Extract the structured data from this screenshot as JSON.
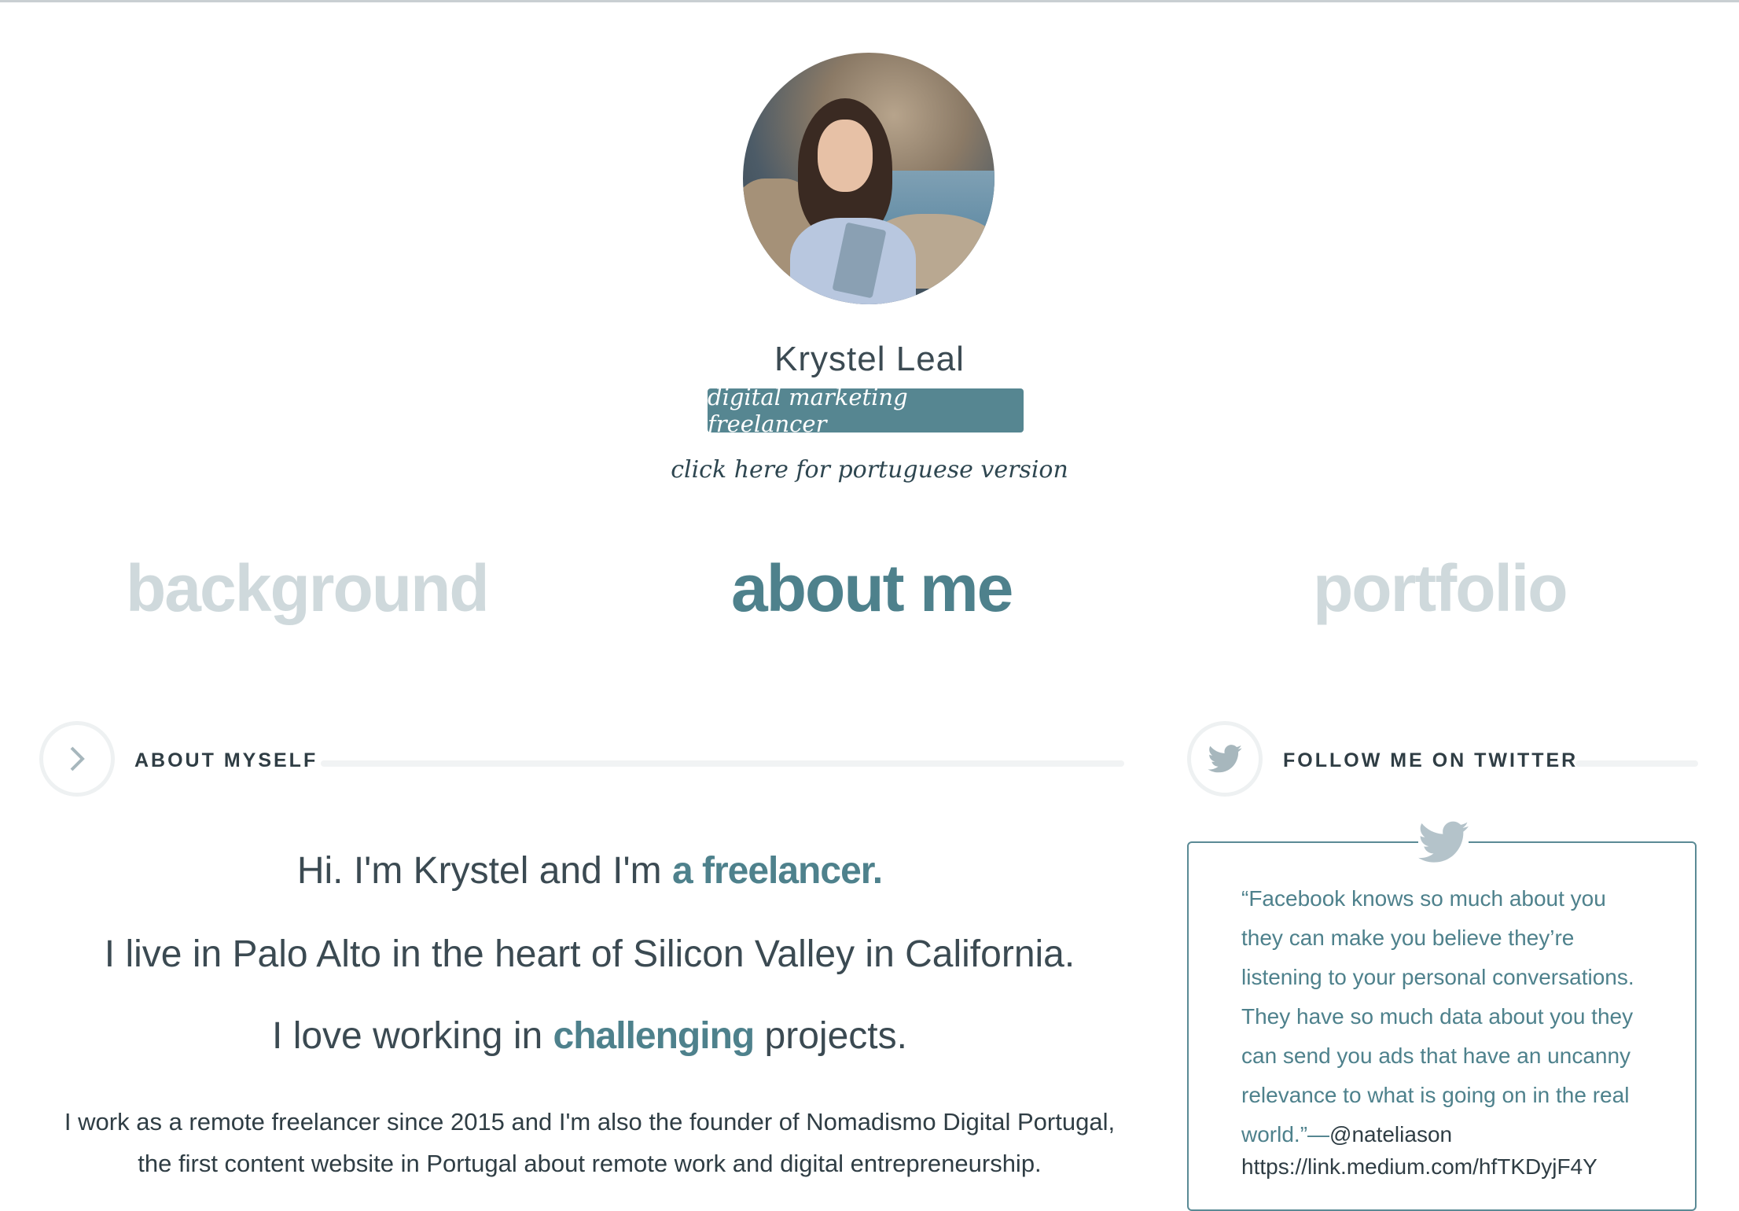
{
  "profile": {
    "name": "Krystel Leal",
    "tagline": "digital marketing freelancer",
    "language_link": "click here for portuguese version"
  },
  "nav": {
    "background": "background",
    "about": "about me",
    "portfolio": "portfolio"
  },
  "about_section": {
    "heading": "ABOUT MYSELF",
    "line1_prefix": "Hi. I'm Krystel and I'm ",
    "line1_highlight": "a freelancer.",
    "line2": "I live in Palo Alto in the heart of Silicon Valley in California.",
    "line3_prefix": "I love working in ",
    "line3_highlight": "challenging",
    "line3_suffix": " projects.",
    "paragraph_line1": "I work as a remote freelancer since 2015 and I'm also the founder of Nomadismo Digital Portugal,",
    "paragraph_line2": "the first content website in Portugal about remote work and digital entrepreneurship."
  },
  "twitter_section": {
    "heading": "FOLLOW ME ON TWITTER",
    "tweet_text": "“Facebook knows so much about you they can make you believe they’re listening to your personal conversations. They have so much data about you they can send you ads that have an uncanny relevance to what is going on in the real world.”—",
    "tweet_handle": "@nateliason",
    "tweet_url": "https://link.medium.com/hfTKDyjF4Y"
  },
  "colors": {
    "accent": "#568691",
    "nav_inactive": "#cfd9dc",
    "text": "#3b4a52"
  },
  "icons": {
    "about": "chevron-right-icon",
    "twitter": "twitter-bird-icon"
  }
}
